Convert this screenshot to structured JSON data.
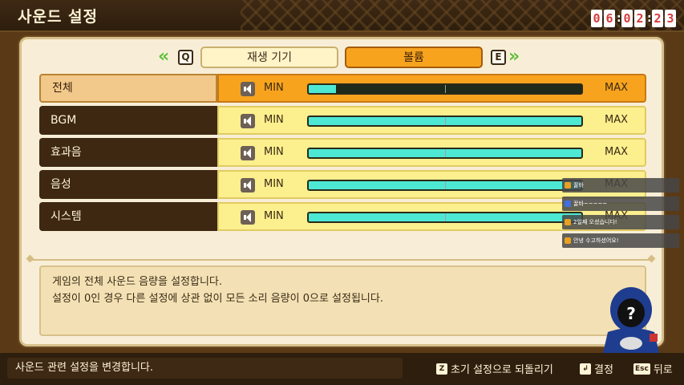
{
  "header": {
    "title": "사운드 설정",
    "clock": [
      "0",
      "6",
      "0",
      "2",
      "2",
      "3"
    ]
  },
  "tabs": {
    "prev_key": "Q",
    "next_key": "E",
    "items": [
      {
        "label": "재생 기기",
        "active": false
      },
      {
        "label": "볼륨",
        "active": true
      }
    ]
  },
  "volume": {
    "min_label": "MIN",
    "max_label": "MAX",
    "rows": [
      {
        "label": "전체",
        "level": 0.1,
        "selected": true
      },
      {
        "label": "BGM",
        "level": 1.0,
        "selected": false
      },
      {
        "label": "효과음",
        "level": 1.0,
        "selected": false
      },
      {
        "label": "음성",
        "level": 1.0,
        "selected": false
      },
      {
        "label": "시스템",
        "level": 1.0,
        "selected": false
      }
    ]
  },
  "description": {
    "line1": "게임의 전체 사운드 음량을 설정합니다.",
    "line2": "설정이 0인 경우 다른 설정에 상관 없이 모든 소리 음량이 0으로 설정됩니다."
  },
  "footer": {
    "status": "사운드 관련 설정을 변경합니다.",
    "reset_key": "Z",
    "reset_label": "초기 설정으로 되돌리기",
    "confirm_key": "↲",
    "confirm_label": "결정",
    "back_key": "Esc",
    "back_label": "뒤로"
  },
  "chat": [
    {
      "text": "꿀바",
      "color": "#e8a020"
    },
    {
      "text": "꿀바~~~~~",
      "color": "#4070e0"
    },
    {
      "text": "2일째 오셨습니다!",
      "color": "#e8a020"
    },
    {
      "text": "안녕 수고하셨어요!",
      "color": "#e8a020"
    }
  ],
  "colors": {
    "accent": "#f7a31e",
    "bar_fill": "#4de8d4",
    "row_bg": "#fcef8e"
  }
}
